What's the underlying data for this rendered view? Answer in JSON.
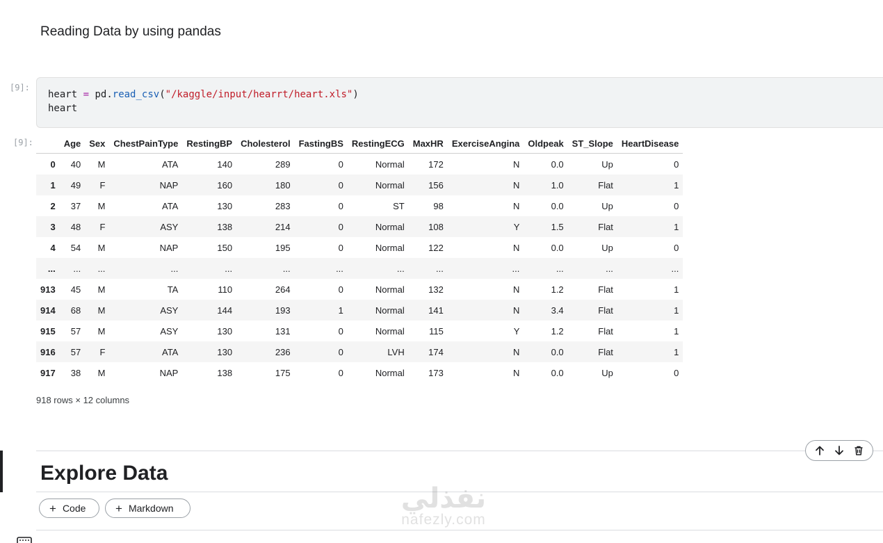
{
  "markdown_cell": {
    "text": "Reading Data by using pandas"
  },
  "code_cell": {
    "prompt": "[9]:",
    "line1": {
      "var": "heart",
      "op": "=",
      "module": "pd",
      "dot": ".",
      "func": "read_csv",
      "open": "(",
      "arg": "\"/kaggle/input/hearrt/heart.xls\"",
      "close": ")"
    },
    "line2": "heart"
  },
  "output": {
    "prompt": "[9]:",
    "table": {
      "columns": [
        "",
        "Age",
        "Sex",
        "ChestPainType",
        "RestingBP",
        "Cholesterol",
        "FastingBS",
        "RestingECG",
        "MaxHR",
        "ExerciseAngina",
        "Oldpeak",
        "ST_Slope",
        "HeartDisease"
      ],
      "rows": [
        [
          "0",
          "40",
          "M",
          "ATA",
          "140",
          "289",
          "0",
          "Normal",
          "172",
          "N",
          "0.0",
          "Up",
          "0"
        ],
        [
          "1",
          "49",
          "F",
          "NAP",
          "160",
          "180",
          "0",
          "Normal",
          "156",
          "N",
          "1.0",
          "Flat",
          "1"
        ],
        [
          "2",
          "37",
          "M",
          "ATA",
          "130",
          "283",
          "0",
          "ST",
          "98",
          "N",
          "0.0",
          "Up",
          "0"
        ],
        [
          "3",
          "48",
          "F",
          "ASY",
          "138",
          "214",
          "0",
          "Normal",
          "108",
          "Y",
          "1.5",
          "Flat",
          "1"
        ],
        [
          "4",
          "54",
          "M",
          "NAP",
          "150",
          "195",
          "0",
          "Normal",
          "122",
          "N",
          "0.0",
          "Up",
          "0"
        ],
        [
          "...",
          "...",
          "...",
          "...",
          "...",
          "...",
          "...",
          "...",
          "...",
          "...",
          "...",
          "...",
          "..."
        ],
        [
          "913",
          "45",
          "M",
          "TA",
          "110",
          "264",
          "0",
          "Normal",
          "132",
          "N",
          "1.2",
          "Flat",
          "1"
        ],
        [
          "914",
          "68",
          "M",
          "ASY",
          "144",
          "193",
          "1",
          "Normal",
          "141",
          "N",
          "3.4",
          "Flat",
          "1"
        ],
        [
          "915",
          "57",
          "M",
          "ASY",
          "130",
          "131",
          "0",
          "Normal",
          "115",
          "Y",
          "1.2",
          "Flat",
          "1"
        ],
        [
          "916",
          "57",
          "F",
          "ATA",
          "130",
          "236",
          "0",
          "LVH",
          "174",
          "N",
          "0.0",
          "Flat",
          "1"
        ],
        [
          "917",
          "38",
          "M",
          "NAP",
          "138",
          "175",
          "0",
          "Normal",
          "173",
          "N",
          "0.0",
          "Up",
          "0"
        ]
      ]
    },
    "shape_text": "918 rows × 12 columns"
  },
  "explore_cell": {
    "heading": "Explore Data"
  },
  "cell_toolbar": {
    "icons": [
      "arrow-up-icon",
      "arrow-down-icon",
      "trash-icon"
    ]
  },
  "add_buttons": {
    "code_label": "Code",
    "markdown_label": "Markdown",
    "plus": "+"
  },
  "watermark": {
    "arabic": "نفذلي",
    "latin": "nafezly.com"
  }
}
